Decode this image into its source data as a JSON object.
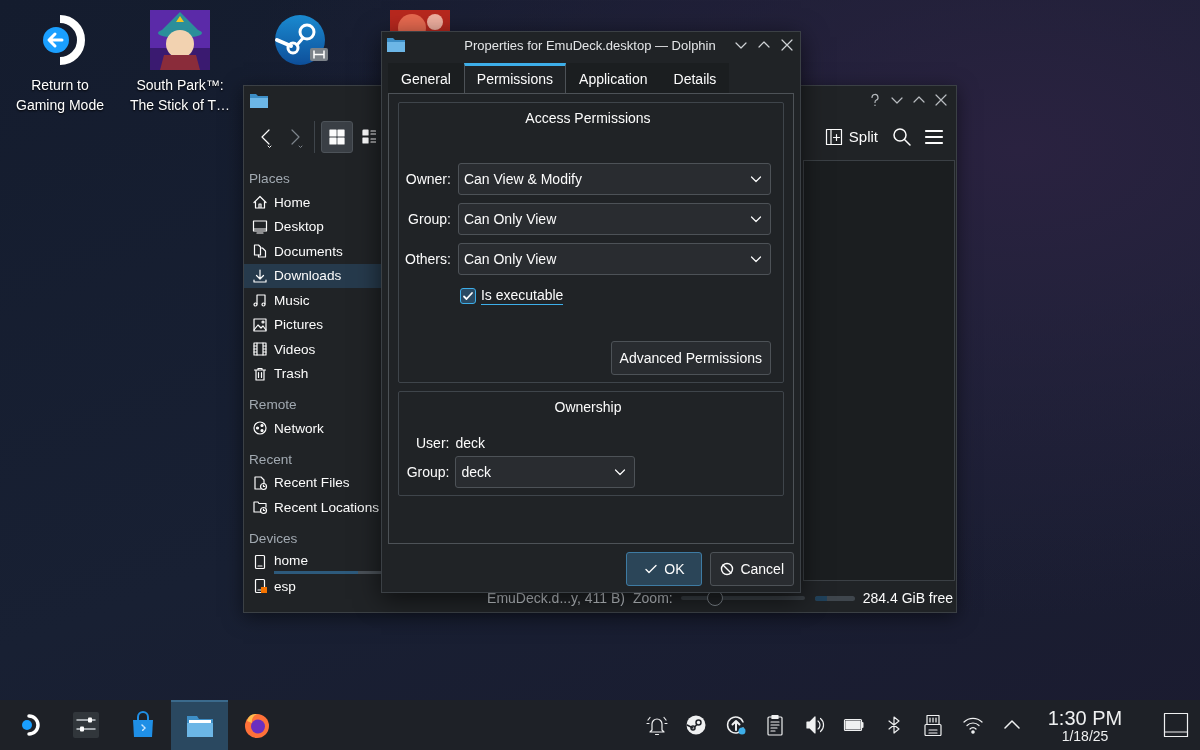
{
  "desktop_icons": [
    {
      "kind": "return",
      "label": "Return to\nGaming Mode"
    },
    {
      "kind": "picture",
      "label": "South Park™:\nThe Stick of T…"
    },
    {
      "kind": "launcher"
    },
    {
      "kind": "picture"
    }
  ],
  "file_manager": {
    "toolbar": {
      "view_modes": [
        {
          "kind": "icons",
          "selected": true
        },
        {
          "kind": "details",
          "selected": false
        }
      ],
      "split_label": "Split"
    },
    "places": [
      {
        "heading": "Places",
        "items": [
          {
            "kind": "home",
            "label": "Home",
            "selected": false
          },
          {
            "kind": "desktop",
            "label": "Desktop",
            "selected": false
          },
          {
            "kind": "documents",
            "label": "Documents",
            "selected": false
          },
          {
            "kind": "downloads",
            "label": "Downloads",
            "selected": true
          },
          {
            "kind": "music",
            "label": "Music",
            "selected": false
          },
          {
            "kind": "pictures",
            "label": "Pictures",
            "selected": false
          },
          {
            "kind": "videos",
            "label": "Videos",
            "selected": false
          },
          {
            "kind": "trash",
            "label": "Trash",
            "selected": false
          }
        ]
      },
      {
        "heading": "Remote",
        "items": [
          {
            "kind": "network",
            "label": "Network",
            "selected": false
          }
        ]
      },
      {
        "heading": "Recent",
        "items": [
          {
            "kind": "recent-files",
            "label": "Recent Files",
            "selected": false
          },
          {
            "kind": "recent-locations",
            "label": "Recent Locations",
            "selected": false
          }
        ]
      },
      {
        "heading": "Devices",
        "items": [
          {
            "kind": "drive",
            "label": "home",
            "selected": false,
            "level": 0.6
          },
          {
            "kind": "drive-badge",
            "label": "esp",
            "selected": false
          }
        ]
      }
    ],
    "status": {
      "text": "EmuDeck.d...y, 411 B)",
      "zoom_label": "Zoom:",
      "zoom": {
        "level": 0.28
      },
      "space": {
        "level": 0.3
      },
      "free": "284.4 GiB free"
    }
  },
  "dialog": {
    "title": "Properties for EmuDeck.desktop — Dolphin",
    "tabs": [
      {
        "label": "General",
        "selected": false
      },
      {
        "label": "Permissions",
        "selected": true
      },
      {
        "label": "Application",
        "selected": false
      },
      {
        "label": "Details",
        "selected": false
      }
    ],
    "access": {
      "title": "Access Permissions",
      "rows": [
        {
          "label": "Owner:",
          "value": "Can View & Modify"
        },
        {
          "label": "Group:",
          "value": "Can Only View"
        },
        {
          "label": "Others:",
          "value": "Can Only View"
        }
      ],
      "executable": {
        "label": "Is executable",
        "checked": true
      },
      "advanced_button": "Advanced Permissions"
    },
    "ownership": {
      "title": "Ownership",
      "user_label": "User:",
      "user": "deck",
      "group_label": "Group:",
      "group": "deck"
    },
    "buttons": [
      {
        "kind": "ok",
        "label": "OK",
        "default": true
      },
      {
        "kind": "cancel",
        "label": "Cancel",
        "default": false
      }
    ]
  },
  "taskbar": {
    "launchers": [
      {
        "kind": "deck",
        "active": false
      },
      {
        "kind": "settings",
        "active": false
      },
      {
        "kind": "store",
        "active": false
      },
      {
        "kind": "files",
        "active": true
      },
      {
        "kind": "browser",
        "active": false
      }
    ],
    "tray": [
      {
        "kind": "notifications"
      },
      {
        "kind": "steam"
      },
      {
        "kind": "update"
      },
      {
        "kind": "clipboard"
      },
      {
        "kind": "volume"
      },
      {
        "kind": "battery"
      },
      {
        "kind": "bluetooth"
      },
      {
        "kind": "usb"
      },
      {
        "kind": "wifi"
      },
      {
        "kind": "expand"
      }
    ],
    "clock": {
      "time": "1:30 PM",
      "date": "1/18/25"
    }
  }
}
